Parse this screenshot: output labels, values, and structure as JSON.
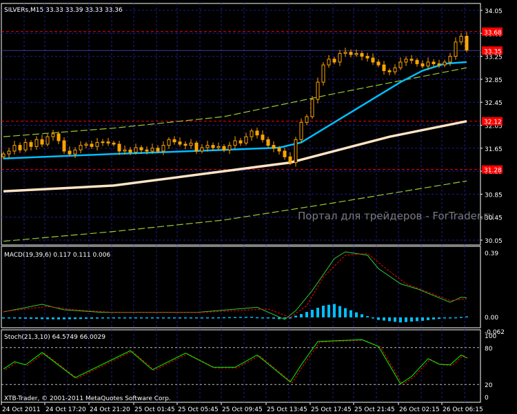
{
  "chart_data": [
    {
      "type": "candlestick",
      "title": "SILVERs,M15  33.33 33.39 33.33 33.36",
      "symbol": "SILVERs",
      "timeframe": "M15",
      "ylim": [
        30.05,
        34.05
      ],
      "y_ticks": [
        "34.05",
        "33.65",
        "33.25",
        "32.85",
        "32.45",
        "32.05",
        "31.65",
        "31.25",
        "30.85",
        "30.45",
        "30.05"
      ],
      "price_labels": [
        {
          "value": 33.68,
          "text": "33.68"
        },
        {
          "value": 33.35,
          "text": "33.35"
        },
        {
          "value": 32.12,
          "text": "32.12"
        },
        {
          "value": 31.28,
          "text": "31.28"
        }
      ],
      "closes": [
        31.55,
        31.6,
        31.7,
        31.62,
        31.75,
        31.68,
        31.8,
        31.72,
        31.85,
        31.9,
        31.78,
        31.6,
        31.55,
        31.62,
        31.7,
        31.72,
        31.68,
        31.75,
        31.76,
        31.74,
        31.72,
        31.6,
        31.62,
        31.58,
        31.66,
        31.62,
        31.6,
        31.65,
        31.6,
        31.7,
        31.8,
        31.76,
        31.72,
        31.7,
        31.74,
        31.6,
        31.66,
        31.7,
        31.66,
        31.68,
        31.62,
        31.7,
        31.78,
        31.74,
        31.85,
        31.95,
        31.88,
        31.8,
        31.7,
        31.65,
        31.6,
        31.5,
        31.4,
        31.8,
        32.1,
        32.2,
        32.5,
        32.8,
        33.1,
        33.2,
        33.15,
        33.3,
        33.32,
        33.28,
        33.3,
        33.25,
        33.22,
        33.15,
        33.1,
        33.0,
        32.98,
        33.05,
        33.15,
        33.2,
        33.18,
        33.12,
        33.08,
        33.15,
        33.12,
        33.1,
        33.15,
        33.25,
        33.5,
        33.6,
        33.36
      ],
      "series": [
        {
          "name": "MA fast",
          "color": "#00bfff",
          "points": [
            [
              0,
              31.47
            ],
            [
              20,
              31.55
            ],
            [
              40,
              31.62
            ],
            [
              50,
              31.66
            ],
            [
              54,
              31.75
            ],
            [
              60,
              32.1
            ],
            [
              66,
              32.45
            ],
            [
              72,
              32.8
            ],
            [
              76,
              33.0
            ],
            [
              80,
              33.12
            ],
            [
              84,
              33.15
            ]
          ]
        },
        {
          "name": "MA slow",
          "color": "#ffe4c4",
          "points": [
            [
              0,
              30.9
            ],
            [
              20,
              31.0
            ],
            [
              40,
              31.25
            ],
            [
              52,
              31.4
            ],
            [
              60,
              31.6
            ],
            [
              70,
              31.85
            ],
            [
              84,
              32.12
            ]
          ]
        },
        {
          "name": "Envelope upper",
          "color": "#9acd32",
          "points": [
            [
              0,
              31.85
            ],
            [
              20,
              32.0
            ],
            [
              40,
              32.2
            ],
            [
              60,
              32.6
            ],
            [
              84,
              33.05
            ]
          ]
        },
        {
          "name": "Envelope lower",
          "color": "#9acd32",
          "points": [
            [
              0,
              30.03
            ],
            [
              20,
              30.2
            ],
            [
              40,
              30.4
            ],
            [
              60,
              30.7
            ],
            [
              84,
              31.08
            ]
          ]
        }
      ],
      "watermark": "Портал для трейдеров - ForTrader.ru"
    },
    {
      "type": "line",
      "title": "MACD(19,39,6) 0.117 0.111 0.006",
      "ylim": [
        -0.062,
        0.39
      ],
      "y_ticks": [
        "0.39",
        "0.00",
        "-0.062"
      ],
      "main": [
        [
          0,
          0.033
        ],
        [
          7,
          0.078
        ],
        [
          11,
          0.045
        ],
        [
          18,
          0.03
        ],
        [
          35,
          0.03
        ],
        [
          46,
          0.06
        ],
        [
          51,
          -0.012
        ],
        [
          53,
          0.04
        ],
        [
          56,
          0.16
        ],
        [
          60,
          0.35
        ],
        [
          62,
          0.39
        ],
        [
          66,
          0.37
        ],
        [
          68,
          0.29
        ],
        [
          72,
          0.2
        ],
        [
          75,
          0.17
        ],
        [
          78,
          0.13
        ],
        [
          81,
          0.09
        ],
        [
          83,
          0.12
        ],
        [
          84,
          0.117
        ]
      ],
      "signal": [
        [
          0,
          0.035
        ],
        [
          8,
          0.065
        ],
        [
          13,
          0.045
        ],
        [
          20,
          0.03
        ],
        [
          36,
          0.03
        ],
        [
          48,
          0.05
        ],
        [
          52,
          0.0
        ],
        [
          55,
          0.07
        ],
        [
          58,
          0.24
        ],
        [
          62,
          0.37
        ],
        [
          66,
          0.38
        ],
        [
          69,
          0.3
        ],
        [
          73,
          0.2
        ],
        [
          77,
          0.15
        ],
        [
          81,
          0.1
        ],
        [
          84,
          0.111
        ]
      ],
      "histogram": [
        [
          0,
          -0.005
        ],
        [
          10,
          -0.012
        ],
        [
          20,
          -0.005
        ],
        [
          30,
          -0.005
        ],
        [
          45,
          0.004
        ],
        [
          50,
          -0.01
        ],
        [
          52,
          0.0
        ],
        [
          54,
          0.02
        ],
        [
          58,
          0.07
        ],
        [
          60,
          0.08
        ],
        [
          64,
          0.03
        ],
        [
          68,
          -0.015
        ],
        [
          72,
          -0.03
        ],
        [
          76,
          -0.02
        ],
        [
          80,
          -0.005
        ],
        [
          84,
          0.006
        ]
      ],
      "colors": {
        "main": "#32cd32",
        "signal": "#ff0000",
        "histogram": "#00bfff"
      }
    },
    {
      "type": "line",
      "title": "Stoch(21,3,10) 64.5749 66.0029",
      "ylim": [
        0,
        100
      ],
      "y_ticks": [
        "100",
        "80",
        "20",
        "0"
      ],
      "levels": [
        80,
        20
      ],
      "main": [
        [
          0,
          45
        ],
        [
          2,
          57
        ],
        [
          4,
          52
        ],
        [
          7,
          72
        ],
        [
          13,
          31
        ],
        [
          23,
          75
        ],
        [
          27,
          44
        ],
        [
          33,
          71
        ],
        [
          38,
          48
        ],
        [
          42,
          48
        ],
        [
          46,
          68
        ],
        [
          52,
          24
        ],
        [
          54,
          52
        ],
        [
          57,
          90
        ],
        [
          65,
          93
        ],
        [
          68,
          82
        ],
        [
          72,
          21
        ],
        [
          74,
          33
        ],
        [
          77,
          62
        ],
        [
          79,
          53
        ],
        [
          81,
          52
        ],
        [
          83,
          68
        ],
        [
          84,
          63
        ]
      ],
      "colors": {
        "main": "#00ff00",
        "signal": "#ff0000"
      }
    }
  ],
  "time_axis": [
    "24 Oct 2011",
    "24 Oct 17:20",
    "24 Oct 21:20",
    "25 Oct 01:45",
    "25 Oct 05:45",
    "25 Oct 09:45",
    "25 Oct 13:45",
    "25 Oct 17:45",
    "25 Oct 21:45",
    "26 Oct 02:15",
    "26 Oct 06:15"
  ],
  "footer": "XTB-Trader, © 2001-2011 MetaQuotes Software Corp.",
  "colors": {
    "candle": "#ffa500",
    "grid": "#1e1e8c",
    "level": "#ff0000",
    "label_bg": "#ff0000"
  }
}
